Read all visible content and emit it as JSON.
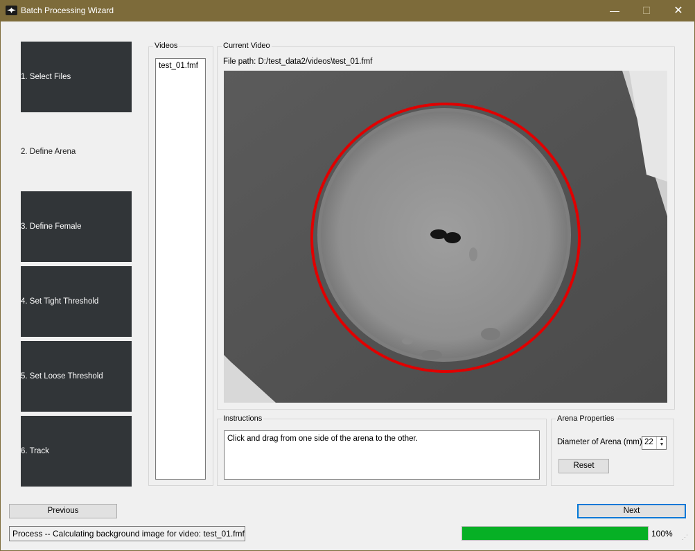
{
  "window": {
    "title": "Batch Processing Wizard",
    "minimize": "—",
    "maximize": "☐",
    "close": "✕"
  },
  "steps": [
    {
      "label": "1. Select Files",
      "active": false
    },
    {
      "label": "2. Define Arena",
      "active": true
    },
    {
      "label": "3. Define Female",
      "active": false
    },
    {
      "label": "4. Set Tight Threshold",
      "active": false
    },
    {
      "label": "5. Set Loose Threshold",
      "active": false
    },
    {
      "label": "6. Track",
      "active": false
    }
  ],
  "videos": {
    "title": "Videos",
    "items": [
      "test_01.fmf"
    ]
  },
  "current_video": {
    "title": "Current Video",
    "file_path": "File path: D:/test_data2/videos\\test_01.fmf"
  },
  "instructions": {
    "title": "Instructions",
    "text": "Click and drag from one side of the arena to the other."
  },
  "arena_properties": {
    "title": "Arena Properties",
    "diameter_label": "Diameter of Arena (mm)",
    "diameter_value": "22",
    "reset_label": "Reset"
  },
  "nav": {
    "previous": "Previous",
    "next": "Next"
  },
  "status": {
    "text": "Process -- Calculating background image for video: test_01.fmf",
    "progress": 1.0,
    "progress_label": "100%"
  },
  "colors": {
    "titlebar": "#7d6b3a",
    "step_bg": "#313538",
    "arena_circle": "#e00000",
    "progress_fill": "#06b025",
    "next_border": "#0078d7"
  }
}
